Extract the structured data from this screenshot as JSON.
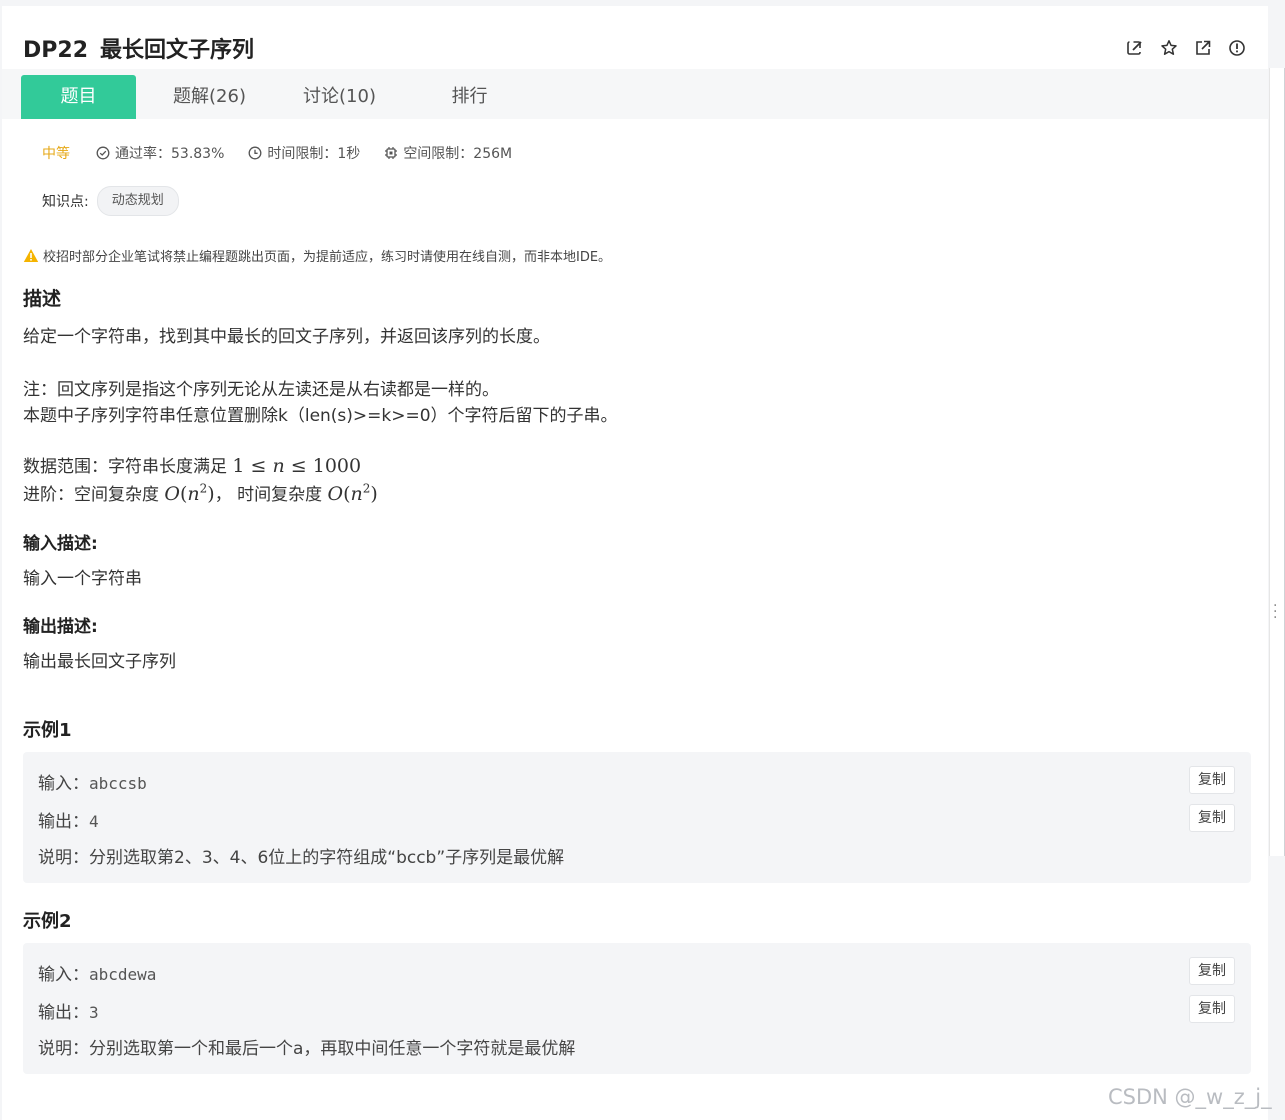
{
  "header": {
    "code": "DP22",
    "title": "最长回文子序列"
  },
  "toolbar": {
    "icons": [
      "edit-icon",
      "star-icon",
      "external-link-icon",
      "report-icon"
    ]
  },
  "tabs": [
    {
      "label": "题目",
      "active": true
    },
    {
      "label": "题解(26)",
      "active": false
    },
    {
      "label": "讨论(10)",
      "active": false
    },
    {
      "label": "排行",
      "active": false
    }
  ],
  "meta": {
    "difficulty": "中等",
    "pass_rate": "通过率：53.83%",
    "time_limit": "时间限制：1秒",
    "space_limit": "空间限制：256M"
  },
  "knowledge": {
    "label": "知识点:",
    "tag": "动态规划"
  },
  "warning": "校招时部分企业笔试将禁止编程题跳出页面，为提前适应，练习时请使用在线自测，而非本地IDE。",
  "description": {
    "heading": "描述",
    "line1": "给定一个字符串，找到其中最长的回文子序列，并返回该序列的长度。",
    "note1": "注：回文序列是指这个序列无论从左读还是从右读都是一样的。",
    "note2": "本题中子序列字符串任意位置删除k（len(s)>=k>=0）个字符后留下的子串。",
    "range_prefix": "数据范围：字符串长度满足",
    "advance_prefix": "进阶：空间复杂度",
    "advance_mid": "， 时间复杂度"
  },
  "input_desc": {
    "heading": "输入描述:",
    "text": "输入一个字符串"
  },
  "output_desc": {
    "heading": "输出描述:",
    "text": "输出最长回文子序列"
  },
  "examples": [
    {
      "heading": "示例1",
      "input_label": "输入：",
      "input": "abccsb",
      "output_label": "输出：",
      "output": "4",
      "explain_label": "说明：",
      "explain": "分别选取第2、3、4、6位上的字符组成“bccb”子序列是最优解",
      "copy": "复制"
    },
    {
      "heading": "示例2",
      "input_label": "输入：",
      "input": "abcdewa",
      "output_label": "输出：",
      "output": "3",
      "explain_label": "说明：",
      "explain": "分别选取第一个和最后一个a，再取中间任意一个字符就是最优解",
      "copy": "复制"
    }
  ],
  "watermark": "CSDN @_w_z_j_",
  "colors": {
    "accent": "#32ca99",
    "difficulty": "#e6a817",
    "warning": "#f5b400"
  }
}
